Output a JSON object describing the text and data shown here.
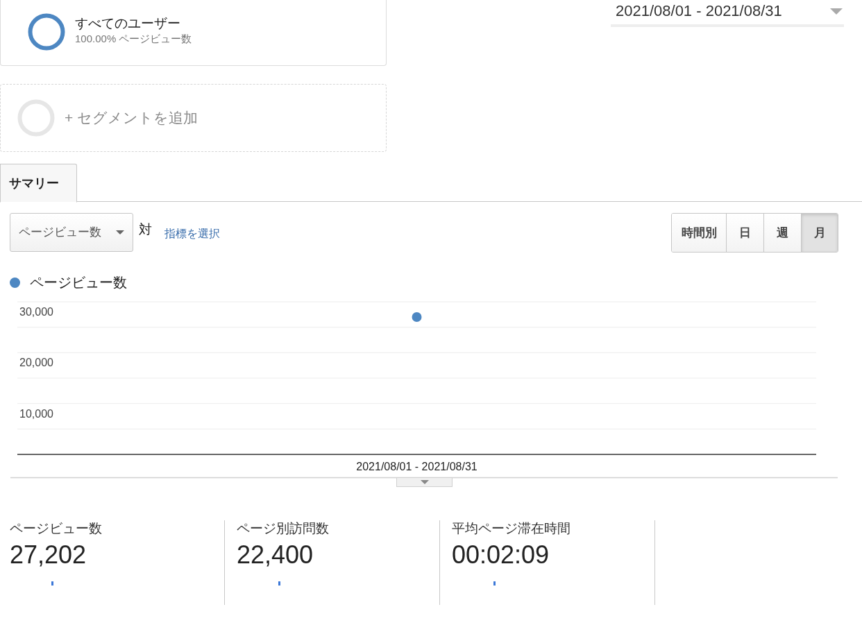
{
  "segments": [
    {
      "kind": "active",
      "title": "すべてのユーザー",
      "subtitle": "100.00% ページビュー数"
    },
    {
      "kind": "add",
      "title": "+ セグメントを追加"
    }
  ],
  "date_range": "2021/08/01 - 2021/08/31",
  "tabs": [
    {
      "label": "サマリー",
      "selected": true
    }
  ],
  "metric_select": {
    "value": "ページビュー数",
    "versus": "対",
    "link": "指標を選択"
  },
  "granularity": [
    {
      "label": "時間別",
      "selected": false
    },
    {
      "label": "日",
      "selected": false
    },
    {
      "label": "週",
      "selected": false
    },
    {
      "label": "月",
      "selected": true
    }
  ],
  "chart": {
    "chart_data": {
      "type": "line",
      "categories": [
        "2021/08/01 - 2021/08/31"
      ],
      "series": [
        {
          "name": "ページビュー数",
          "color": "#4d87c2",
          "values": [
            27000
          ],
          "marker": true
        }
      ],
      "ylim": [
        0,
        30000
      ],
      "yticks": [
        {
          "value": 10000,
          "label": "10,000"
        },
        {
          "value": 20000,
          "label": "20,000"
        },
        {
          "value": 30000,
          "label": "30,000"
        }
      ]
    }
  },
  "metrics": [
    {
      "label": "ページビュー数",
      "value": "27,202"
    },
    {
      "label": "ページ別訪問数",
      "value": "22,400"
    },
    {
      "label": "平均ページ滞在時間",
      "value": "00:02:09"
    }
  ]
}
